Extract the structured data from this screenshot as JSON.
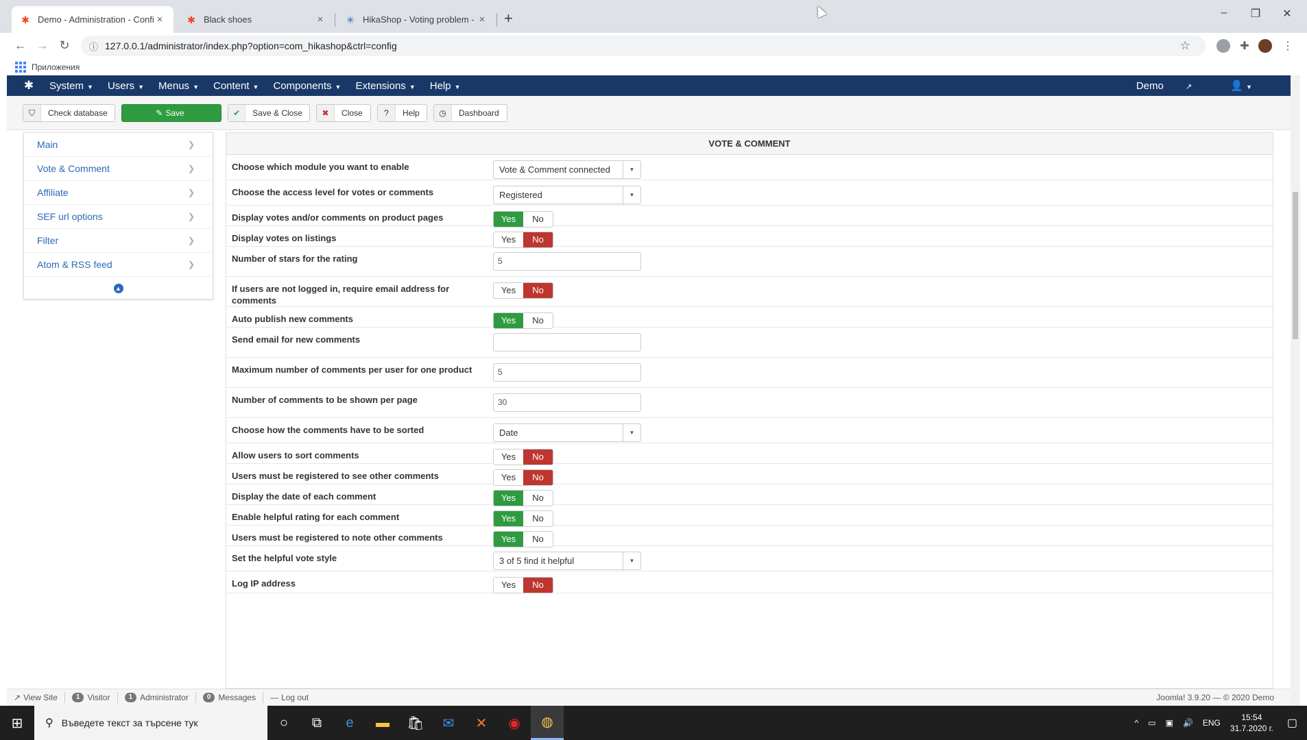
{
  "browser": {
    "tabs": [
      {
        "title": "Demo - Administration - Configu",
        "icon": "joomla-icon"
      },
      {
        "title": "Black shoes",
        "icon": "joomla-icon"
      },
      {
        "title": "HikaShop - Voting problem - Hik",
        "icon": "hikashop-icon"
      }
    ],
    "url": "127.0.0.1/administrator/index.php?option=com_hikashop&ctrl=config",
    "bookmarks_label": "Приложения"
  },
  "joomla_nav": {
    "menus": [
      "System",
      "Users",
      "Menus",
      "Content",
      "Components",
      "Extensions",
      "Help"
    ],
    "site_label": "Demo"
  },
  "toolbar": {
    "check_database": "Check database",
    "save": "Save",
    "save_close": "Save & Close",
    "close": "Close",
    "help": "Help",
    "dashboard": "Dashboard"
  },
  "sidebar": {
    "items": [
      "Main",
      "Vote & Comment",
      "Affiliate",
      "SEF url options",
      "Filter",
      "Atom & RSS feed"
    ]
  },
  "panel": {
    "title": "VOTE & COMMENT",
    "toggle_yes": "Yes",
    "toggle_no": "No",
    "rows": [
      {
        "label": "Choose which module you want to enable",
        "type": "select",
        "value": "Vote & Comment connected"
      },
      {
        "label": "Choose the access level for votes or comments",
        "type": "select",
        "value": "Registered"
      },
      {
        "label": "Display votes and/or comments on product pages",
        "type": "toggle",
        "value": "Yes"
      },
      {
        "label": "Display votes on listings",
        "type": "toggle",
        "value": "No"
      },
      {
        "label": "Number of stars for the rating",
        "type": "input",
        "value": "5"
      },
      {
        "label": "If users are not logged in, require email address for comments",
        "type": "toggle",
        "value": "No"
      },
      {
        "label": "Auto publish new comments",
        "type": "toggle",
        "value": "Yes"
      },
      {
        "label": "Send email for new comments",
        "type": "input",
        "value": ""
      },
      {
        "label": "Maximum number of comments per user for one product",
        "type": "input",
        "value": "5"
      },
      {
        "label": "Number of comments to be shown per page",
        "type": "input",
        "value": "30"
      },
      {
        "label": "Choose how the comments have to be sorted",
        "type": "select",
        "value": "Date"
      },
      {
        "label": "Allow users to sort comments",
        "type": "toggle",
        "value": "No"
      },
      {
        "label": "Users must be registered to see other comments",
        "type": "toggle",
        "value": "No"
      },
      {
        "label": "Display the date of each comment",
        "type": "toggle",
        "value": "Yes"
      },
      {
        "label": "Enable helpful rating for each comment",
        "type": "toggle",
        "value": "Yes"
      },
      {
        "label": "Users must be registered to note other comments",
        "type": "toggle",
        "value": "Yes"
      },
      {
        "label": "Set the helpful vote style",
        "type": "select",
        "value": "3 of 5 find it helpful"
      },
      {
        "label": "Log IP address",
        "type": "toggle",
        "value": "No"
      }
    ]
  },
  "statusbar": {
    "view_site": "View Site",
    "visitor_count": "1",
    "visitor_label": "Visitor",
    "admin_count": "1",
    "admin_label": "Administrator",
    "messages_count": "0",
    "messages_label": "Messages",
    "logout": "Log out",
    "version": "Joomla! 3.9.20 — © 2020 Demo"
  },
  "taskbar": {
    "search_placeholder": "Въведете текст за търсене тук",
    "lang": "ENG",
    "time": "15:54",
    "date": "31.7.2020 г."
  },
  "colors": {
    "joomla_nav": "#1a3867",
    "yes_active": "#2f9b41",
    "no_active": "#bd362f",
    "link": "#2a69b8"
  }
}
